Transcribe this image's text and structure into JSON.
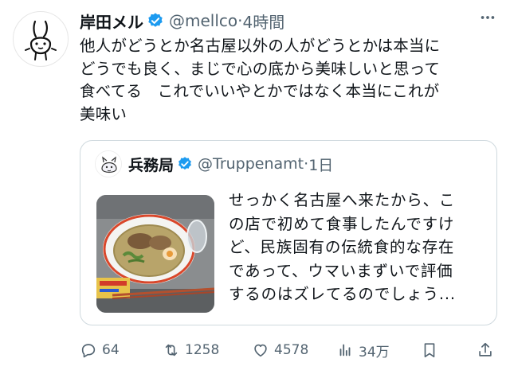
{
  "tweet": {
    "author_name": "岸田メル",
    "handle": "@mellco",
    "separator": "·",
    "time": "4時間",
    "more_icon": "more-dots-icon",
    "text_lines": [
      "他人がどうとか名古屋以外の人がどうとかは本当に",
      "どうでも良く、まじで心の底から美味しいと思って",
      "食べてる　これでいいやとかではなく本当にこれが",
      "美味い"
    ]
  },
  "quote": {
    "author_name": "兵務局",
    "handle": "@Truppenamt",
    "separator": "·",
    "time": "1日",
    "image_label": "ramen-bowl-photo",
    "text_lines": [
      "せっかく名古屋へ来たから、こ",
      "の店で初めて食事したんですけ",
      "ど、民族固有の伝統食的な存在",
      "であって、ウマいまずいで評価",
      "するのはズレてるのでしょう..."
    ]
  },
  "actions": {
    "reply_count": "64",
    "retweet_count": "1258",
    "like_count": "4578",
    "views_count": "34万"
  },
  "colors": {
    "verified_blue": "#1d9bf0",
    "text_primary": "#0f1419",
    "text_secondary": "#536471",
    "border": "#cfd9de"
  }
}
